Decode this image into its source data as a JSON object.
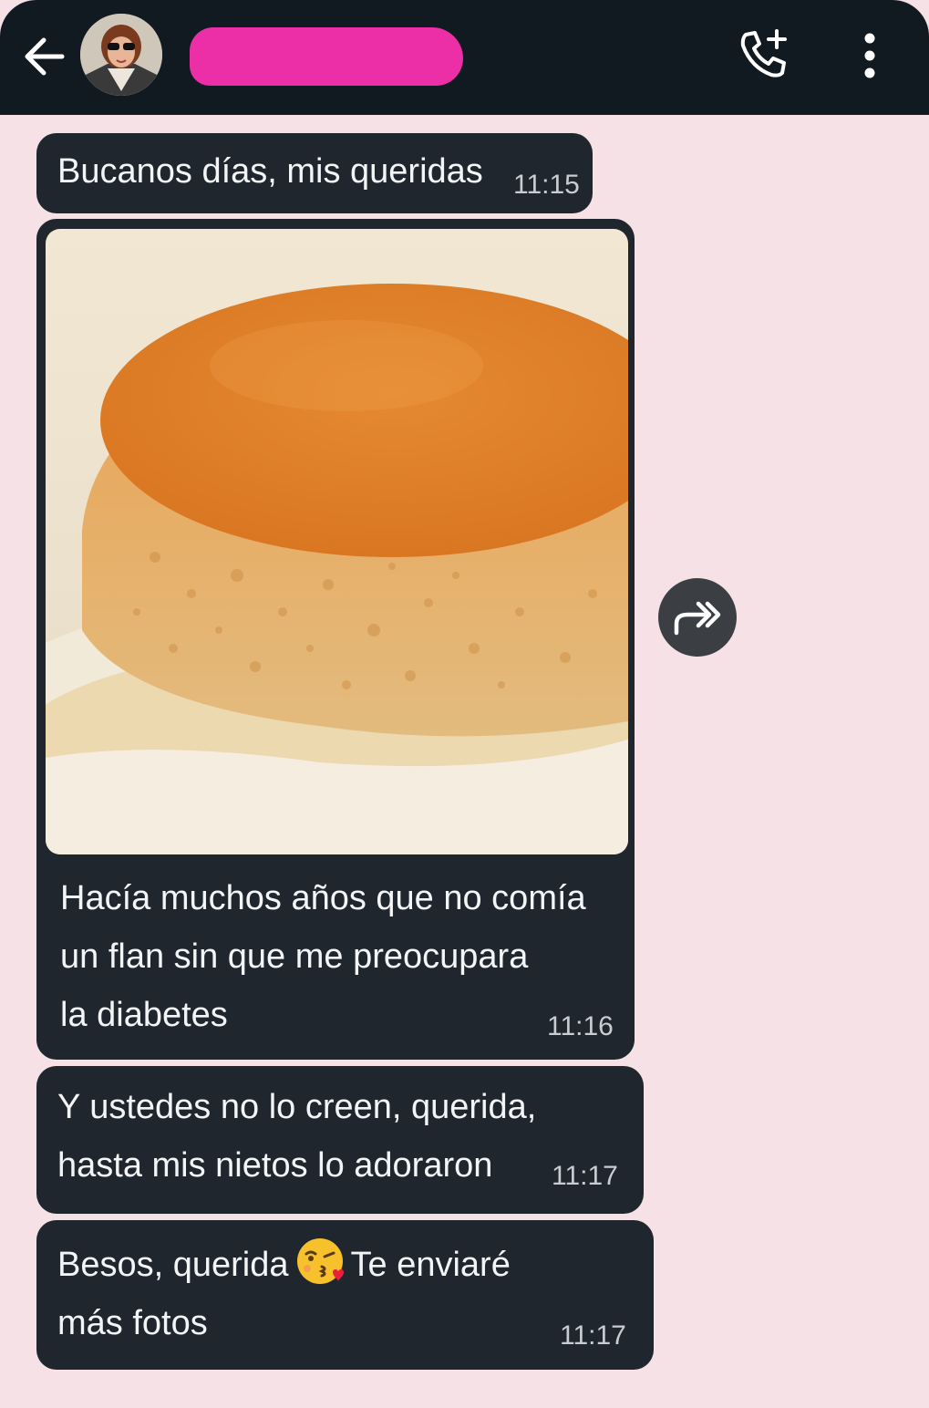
{
  "header": {
    "back_icon": "arrow-left-icon",
    "call_icon": "add-call-icon",
    "menu_icon": "more-vertical-icon"
  },
  "messages": [
    {
      "text": "Bucanos días, mis queridas",
      "time": "11:15"
    },
    {
      "image": "caramel flan photo",
      "text": "Hacía muchos años que no comía\nun flan sin que me preocupara\nla diabetes",
      "time": "11:16"
    },
    {
      "text": "Y ustedes no lo creen, querida,\nhasta mis nietos lo adoraron",
      "time": "11:17"
    },
    {
      "text_before": "Besos, querida",
      "emoji": "😘",
      "text_after": "Te enviaré\nmás fotos",
      "time": "11:17"
    }
  ],
  "forward_icon": "forward-icon",
  "colors": {
    "bubble": "#1f262d",
    "background": "#f5e1e6",
    "header": "#121a21",
    "redaction": "#ec2fa6"
  }
}
